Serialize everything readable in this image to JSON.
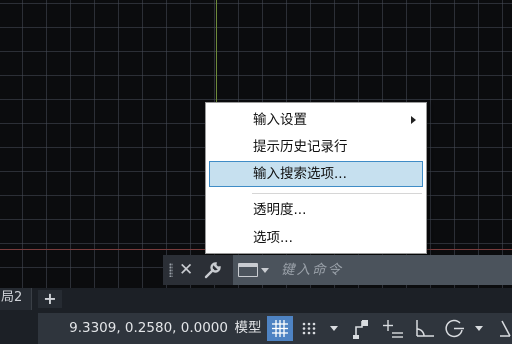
{
  "context_menu": {
    "items": [
      {
        "label": "输入设置",
        "has_submenu": true
      },
      {
        "label": "提示历史记录行"
      },
      {
        "label": "输入搜索选项...",
        "highlighted": true
      },
      {
        "label": "透明度..."
      },
      {
        "label": "选项..."
      }
    ]
  },
  "command_line": {
    "close_icon": "close-icon",
    "settings_icon": "wrench-icon",
    "prompt_icon": "command-prompt-icon",
    "placeholder": "键入命令"
  },
  "layout_tabs": {
    "current_tab": "局2",
    "add_label": "+"
  },
  "status_bar": {
    "coordinates": "9.3309, 0.2580, 0.0000",
    "model_label": "模型",
    "icons": [
      "grid-icon",
      "snap-dots-icon",
      "snap-menu-arrow-icon",
      "ortho-icon",
      "dynamic-input-icon",
      "polar-tracking-icon",
      "object-snap-icon",
      "object-snap-menu-arrow-icon",
      "linetype-icon"
    ]
  },
  "colors": {
    "canvas_bg": "#0b0c0e",
    "menu_highlight": "#c6e0ef",
    "menu_highlight_border": "#3f8cc6",
    "status_active": "#4e83c3",
    "y_axis": "#6e8a3a",
    "x_axis": "#7a3c3c"
  }
}
